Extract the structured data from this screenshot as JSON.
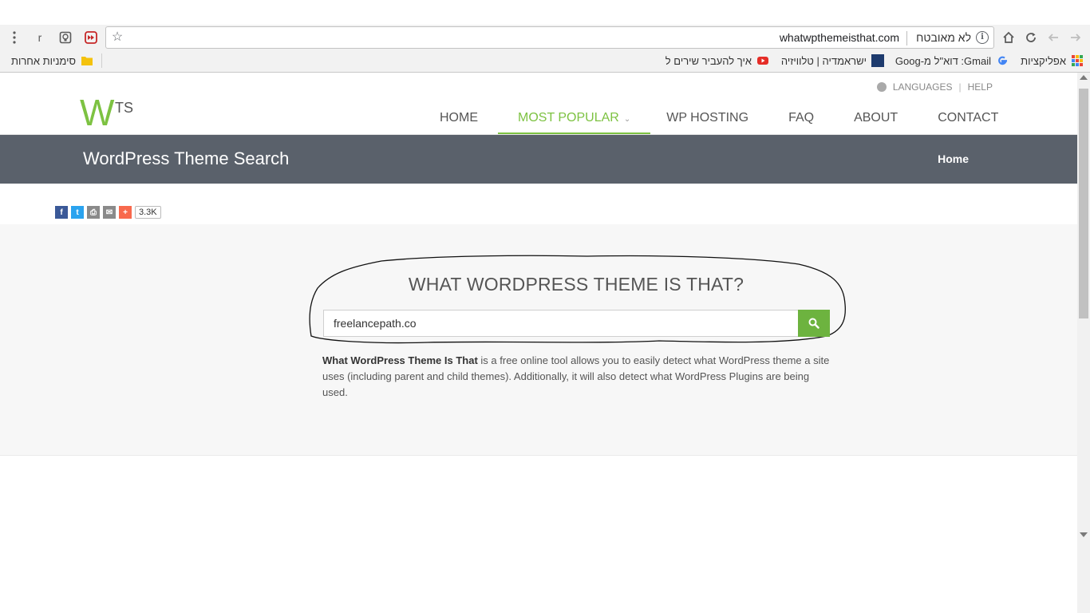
{
  "browser": {
    "url": "whatwpthemeisthat.com",
    "security": "לא מאובטח",
    "bookmarks": {
      "apps": "אפליקציות",
      "gmail": "Gmail: דוא\"ל מ-Goog",
      "israpedia": "ישראמדיה | טלוויזיה",
      "youtube": "איך להעביר שירים ל",
      "other": "סימניות אחרות"
    },
    "ext_label": "r"
  },
  "site": {
    "top_links": {
      "languages": "LANGUAGES",
      "help": "HELP"
    },
    "logo": {
      "mark": "W",
      "text": "TS"
    },
    "nav": [
      {
        "label": "HOME"
      },
      {
        "label": "MOST POPULAR"
      },
      {
        "label": "WP HOSTING"
      },
      {
        "label": "FAQ"
      },
      {
        "label": "ABOUT"
      },
      {
        "label": "CONTACT"
      }
    ],
    "nav_chevron": "⌄",
    "banner": {
      "title": "WordPress Theme Search",
      "breadcrumb": "Home"
    },
    "share": {
      "count": "3.3K",
      "facebook": "f",
      "twitter": "t",
      "print": "⎙",
      "email": "✉",
      "plus": "+"
    },
    "search": {
      "heading": "WHAT WORDPRESS THEME IS THAT?",
      "value": "freelancepath.co",
      "description_bold": "What WordPress Theme Is That",
      "description_rest": " is a free online tool allows you to easily detect what WordPress theme a site uses (including parent and child themes). Additionally, it will also detect what WordPress Plugins are being used."
    }
  },
  "colors": {
    "accent": "#7dc242",
    "banner": "#5a616b",
    "search_button": "#6db33f"
  }
}
